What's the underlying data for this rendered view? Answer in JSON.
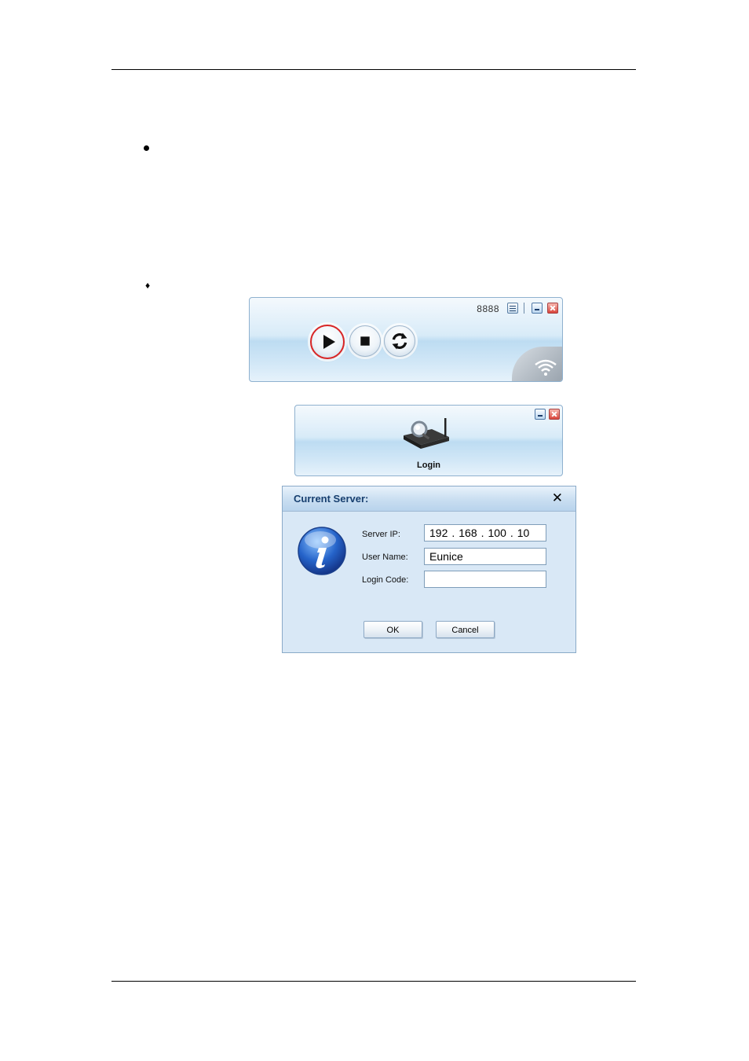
{
  "player": {
    "port": "8888",
    "icons": {
      "menu": "menu-list-icon",
      "minimize": "minimize-icon",
      "close": "close-icon",
      "play": "play-icon",
      "stop": "stop-icon",
      "refresh": "refresh-icon",
      "wifi": "wifi-signal-icon"
    },
    "accent_color": "#d92525"
  },
  "login_panel": {
    "label": "Login",
    "icon": "router-search-icon"
  },
  "dialog": {
    "title": "Current Server:",
    "close_symbol": "✕",
    "icon": "info-icon",
    "fields": {
      "server_ip_label": "Server IP:",
      "server_ip": [
        "192",
        "168",
        "100",
        "10"
      ],
      "user_name_label": "User Name:",
      "user_name": "Eunice",
      "login_code_label": "Login Code:",
      "login_code": ""
    },
    "buttons": {
      "ok": "OK",
      "cancel": "Cancel"
    }
  }
}
